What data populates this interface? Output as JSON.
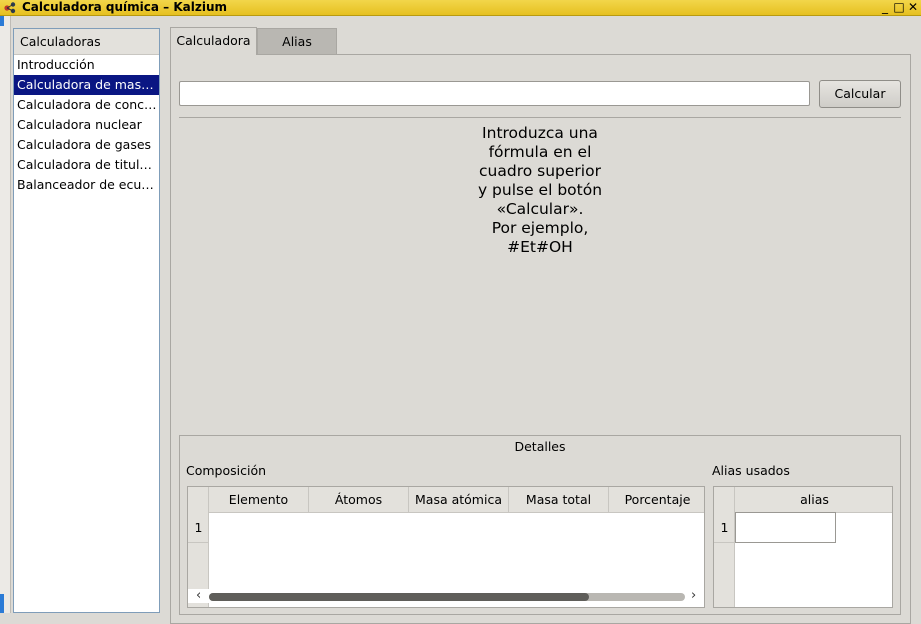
{
  "window": {
    "title": "Calculadora química – Kalzium",
    "controls": {
      "minimize": "_",
      "maximize": "□",
      "close": "✕"
    }
  },
  "sidebar": {
    "header": "Calculadoras",
    "items": [
      {
        "label": "Introducción",
        "selected": false
      },
      {
        "label": "Calculadora de masa…",
        "selected": true
      },
      {
        "label": "Calculadora de conc…",
        "selected": false
      },
      {
        "label": "Calculadora nuclear",
        "selected": false
      },
      {
        "label": "Calculadora de gases",
        "selected": false
      },
      {
        "label": "Calculadora de titula…",
        "selected": false
      },
      {
        "label": "Balanceador de ecua…",
        "selected": false
      }
    ]
  },
  "tabs": [
    {
      "label": "Calculadora",
      "active": true
    },
    {
      "label": "Alias",
      "active": false
    }
  ],
  "formula": {
    "value": "",
    "button_label": "Calcular"
  },
  "instructions": {
    "lines": [
      "Introduzca una",
      "fórmula en el",
      "cuadro superior",
      "y pulse el botón",
      "«Calcular».",
      "Por ejemplo,",
      "#Et#OH"
    ]
  },
  "details": {
    "title": "Detalles",
    "composition_label": "Composición",
    "columns": [
      "Elemento",
      "Átomos",
      "Masa atómica",
      "Masa total",
      "Porcentaje"
    ],
    "row_number": "1",
    "alias_label": "Alias usados",
    "alias_column": "alias",
    "alias_row_number": "1"
  },
  "scroll": {
    "left_arrow": "‹",
    "right_arrow": "›"
  },
  "colors": {
    "selection": "#0a1683",
    "titlebar": "#e6c020",
    "background": "#dcdad5"
  }
}
